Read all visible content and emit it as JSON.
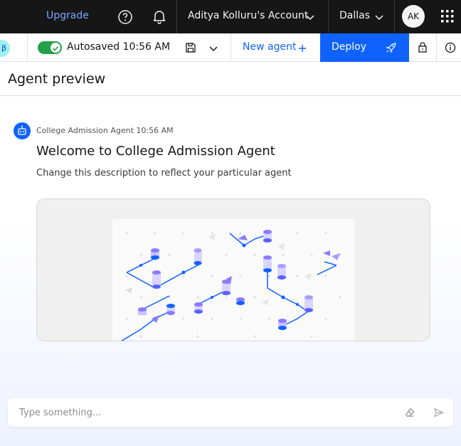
{
  "topbar": {
    "upgrade_label": "Upgrade",
    "account_label": "Aditya Kolluru's Account",
    "region_label": "Dallas",
    "avatar_initials": "AK"
  },
  "toolbar": {
    "beta_label": "β",
    "autosave_label": "Autosaved 10:56 AM",
    "new_agent_label": "New agent",
    "deploy_label": "Deploy"
  },
  "preview": {
    "title": "Agent preview"
  },
  "message": {
    "meta": "College Admission Agent 10:56 AM",
    "title": "Welcome to College Admission Agent",
    "description": "Change this description to reflect your particular agent"
  },
  "input": {
    "placeholder": "Type something..."
  },
  "colors": {
    "accent": "#0f62fe",
    "topbar_bg": "#161616",
    "toggle_on": "#24a148",
    "link": "#78a9ff"
  }
}
